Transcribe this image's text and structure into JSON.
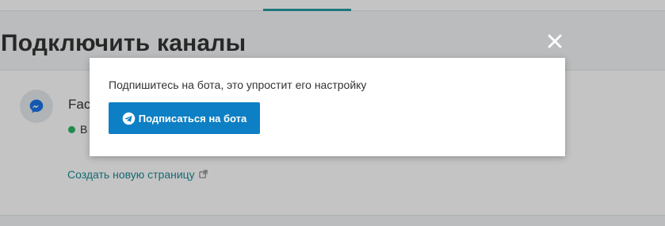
{
  "page": {
    "title": "Подключить каналы"
  },
  "channel": {
    "name": "Fac",
    "status": "В",
    "icon": "messenger-icon",
    "status_color": "#2fb566"
  },
  "card": {
    "create_link": "Создать новую страницу",
    "link_icon": "external-link-icon"
  },
  "modal": {
    "message": "Подпишитесь на бота, это упростит его настройку",
    "button_label": "Подписаться на бота",
    "button_icon": "telegram-icon",
    "button_color": "#0d7fc4",
    "close_icon": "close-icon"
  },
  "colors": {
    "accent": "#2a9ba1",
    "link": "#1e8a95"
  }
}
